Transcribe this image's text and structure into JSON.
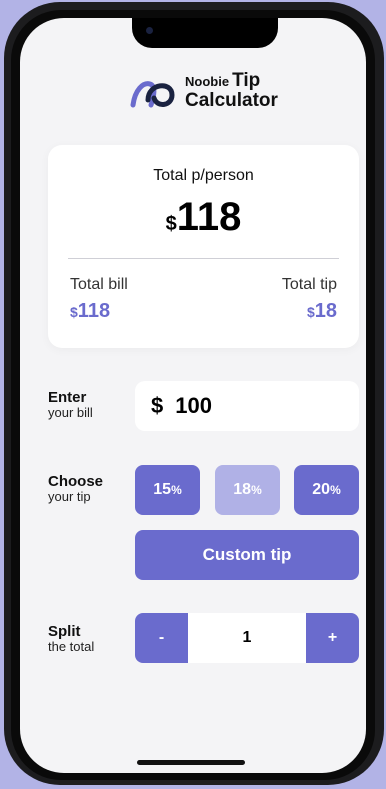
{
  "app": {
    "logo_small": "Noobie",
    "logo_tip": "Tip",
    "logo_calc": "Calculator",
    "logo_icon": "noobie-logo-icon"
  },
  "summary": {
    "per_person_label": "Total p/person",
    "currency": "$",
    "per_person_value": "118",
    "total_bill_label": "Total bill",
    "total_bill_value": "118",
    "total_tip_label": "Total tip",
    "total_tip_value": "18"
  },
  "bill": {
    "label_strong": "Enter",
    "label_sub": "your bill",
    "currency": "$",
    "value": "100"
  },
  "tip": {
    "label_strong": "Choose",
    "label_sub": "your tip",
    "options": [
      {
        "value": "15",
        "unit": "%"
      },
      {
        "value": "18",
        "unit": "%",
        "selected": true
      },
      {
        "value": "20",
        "unit": "%"
      }
    ],
    "custom_label": "Custom tip"
  },
  "split": {
    "label_strong": "Split",
    "label_sub": "the total",
    "decrement": "-",
    "value": "1",
    "increment": "+"
  },
  "colors": {
    "accent": "#6a6bcd",
    "accent_light": "#b0b1e6",
    "background": "#b2b3e6",
    "screen": "#f4f4f6"
  }
}
